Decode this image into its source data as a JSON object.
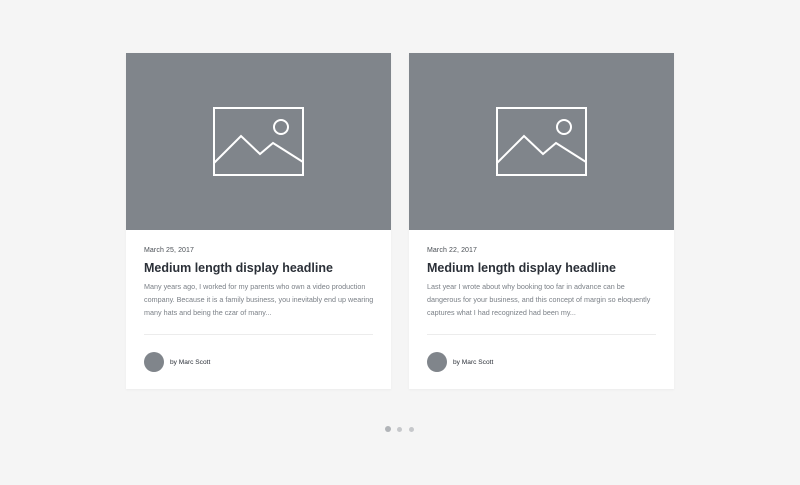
{
  "cards": [
    {
      "date": "March 25, 2017",
      "headline": "Medium length display headline",
      "excerpt": "Many years ago, I worked for my parents who own a video production company. Because it is a family business, you inevitably end up wearing many hats and being the czar of many...",
      "author": "by Marc Scott",
      "image_icon": "image-placeholder-icon"
    },
    {
      "date": "March 22, 2017",
      "headline": "Medium length display headline",
      "excerpt": "Last year I wrote about why booking too far in advance can be dangerous for your business, and this concept of margin so eloquently captures what I had recognized had been my...",
      "author": "by Marc Scott",
      "image_icon": "image-placeholder-icon"
    }
  ],
  "pagination": {
    "total": 3,
    "active_index": 0
  },
  "colors": {
    "background": "#f5f5f5",
    "placeholder": "#80858b",
    "headline": "#2b3038",
    "body_text": "#7b8087"
  }
}
